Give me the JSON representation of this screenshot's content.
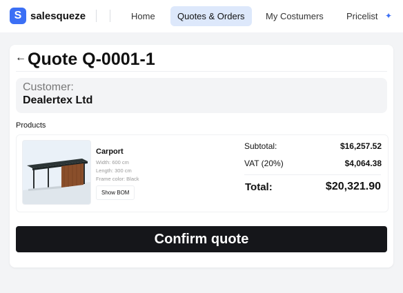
{
  "brand": {
    "name": "salesqueze",
    "logo_letter": "S",
    "accent": "#3b6ff5"
  },
  "nav": {
    "items": [
      {
        "label": "Home",
        "active": false
      },
      {
        "label": "Quotes & Orders",
        "active": true
      },
      {
        "label": "My Costumers",
        "active": false
      },
      {
        "label": "Pricelist",
        "active": false
      }
    ]
  },
  "quote": {
    "title": "Quote Q-0001-1",
    "customer_label": "Customer:",
    "customer_name": "Dealertex Ltd",
    "products_label": "Products",
    "product": {
      "name": "Carport",
      "width": "Width: 600 cm",
      "length": "Length: 300 cm",
      "frame_color": "Frame color: Black",
      "bom_button": "Show BOM"
    },
    "summary": {
      "subtotal_label": "Subtotal:",
      "subtotal_value": "$16,257.52",
      "vat_label": "VAT (20%)",
      "vat_value": "$4,064.38",
      "total_label": "Total:",
      "total_value": "$20,321.90"
    },
    "confirm_label": "Confirm quote"
  }
}
